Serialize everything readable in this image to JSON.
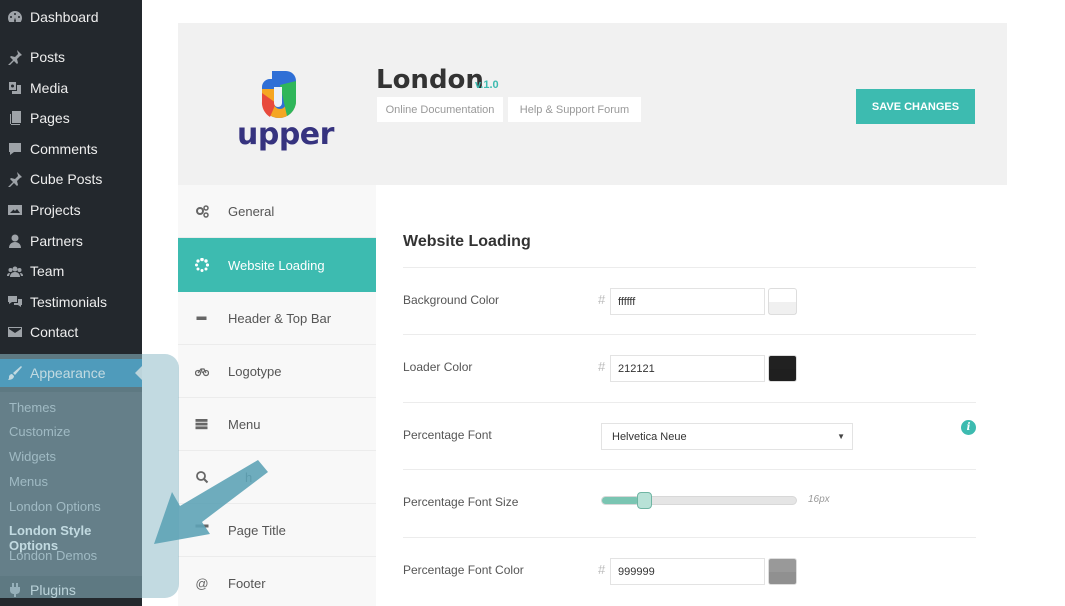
{
  "wp_menu": {
    "items": [
      {
        "label": "Dashboard",
        "icon": "dashboard-icon"
      },
      {
        "label": "Posts",
        "icon": "pin-icon"
      },
      {
        "label": "Media",
        "icon": "media-icon"
      },
      {
        "label": "Pages",
        "icon": "page-icon"
      },
      {
        "label": "Comments",
        "icon": "comment-icon"
      },
      {
        "label": "Cube Posts",
        "icon": "pin-icon"
      },
      {
        "label": "Projects",
        "icon": "image-icon"
      },
      {
        "label": "Partners",
        "icon": "user-icon"
      },
      {
        "label": "Team",
        "icon": "group-icon"
      },
      {
        "label": "Testimonials",
        "icon": "comments-icon"
      },
      {
        "label": "Contact",
        "icon": "mail-icon"
      },
      {
        "label": "Appearance",
        "icon": "brush-icon"
      },
      {
        "label": "Plugins",
        "icon": "plugin-icon"
      }
    ],
    "submenu": [
      "Themes",
      "Customize",
      "Widgets",
      "Menus",
      "London Options",
      "London Style Options",
      "London Demos"
    ],
    "active_item": "Appearance",
    "current_subitem": "London Style Options"
  },
  "header": {
    "logo_text": "upper",
    "title": "London",
    "version": "v.1.0",
    "links": [
      "Online Documentation",
      "Help & Support Forum"
    ],
    "save_label": "SAVE CHANGES"
  },
  "nav": {
    "items": [
      {
        "label": "General",
        "icon": "gears-icon"
      },
      {
        "label": "Website Loading",
        "icon": "spinner-icon"
      },
      {
        "label": "Header & Top Bar",
        "icon": "minus-icon"
      },
      {
        "label": "Logotype",
        "icon": "bicycle-icon"
      },
      {
        "label": "Menu",
        "icon": "bars-icon"
      },
      {
        "label": "Search",
        "icon": "search-icon"
      },
      {
        "label": "Page Title",
        "icon": "title-icon"
      },
      {
        "label": "Footer",
        "icon": "at-icon"
      }
    ],
    "visible_text": {
      "search_partial": "h"
    },
    "active": "Website Loading"
  },
  "content": {
    "heading": "Website Loading",
    "background_color": {
      "label": "Background Color",
      "value": "ffffff",
      "swatch": "#ffffff"
    },
    "loader_color": {
      "label": "Loader Color",
      "value": "212121",
      "swatch": "#212121"
    },
    "percentage_font": {
      "label": "Percentage Font",
      "value": "Helvetica Neue",
      "info_icon": "info-icon"
    },
    "percentage_font_size": {
      "label": "Percentage Font Size",
      "value": "16px",
      "fraction": 0.19
    },
    "percentage_font_color": {
      "label": "Percentage Font Color",
      "value": "999999",
      "swatch": "#999999"
    },
    "hash_symbol": "#"
  },
  "colors": {
    "accent": "#3dbbb0",
    "wp_sidebar": "#23282d",
    "wp_active": "#0073aa",
    "logo_text": "#36337f"
  }
}
